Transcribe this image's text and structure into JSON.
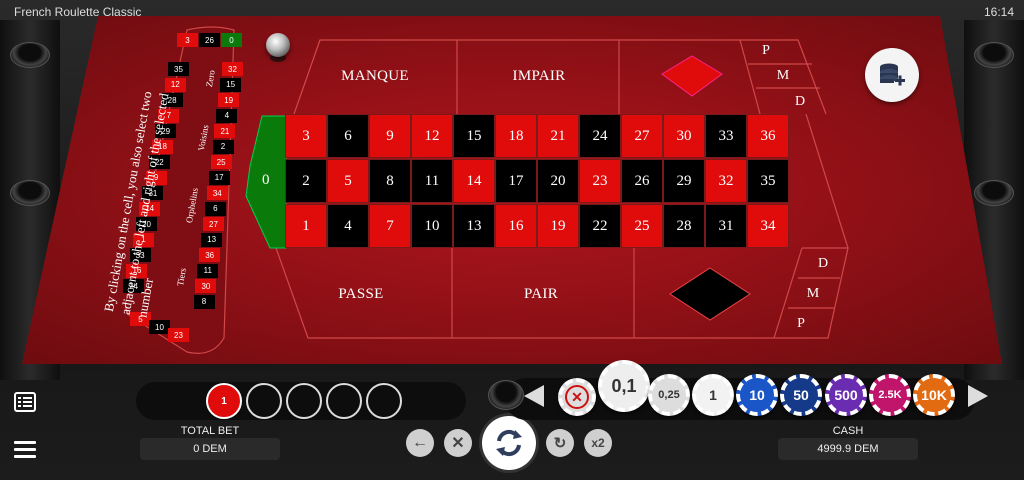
{
  "app": {
    "title": "French Roulette Classic",
    "clock": "16:14"
  },
  "table": {
    "outside_top": [
      "MANQUE",
      "IMPAIR"
    ],
    "outside_bottom": [
      "PASSE",
      "PAIR"
    ],
    "pmd_top": [
      "P",
      "M",
      "D"
    ],
    "pmd_bottom": [
      "D",
      "M",
      "P"
    ],
    "zero": "0",
    "rows": [
      [
        {
          "n": "3",
          "c": "red"
        },
        {
          "n": "6",
          "c": "black"
        },
        {
          "n": "9",
          "c": "red"
        },
        {
          "n": "12",
          "c": "red"
        },
        {
          "n": "15",
          "c": "black"
        },
        {
          "n": "18",
          "c": "red"
        },
        {
          "n": "21",
          "c": "red"
        },
        {
          "n": "24",
          "c": "black"
        },
        {
          "n": "27",
          "c": "red"
        },
        {
          "n": "30",
          "c": "red"
        },
        {
          "n": "33",
          "c": "black"
        },
        {
          "n": "36",
          "c": "red"
        }
      ],
      [
        {
          "n": "2",
          "c": "black"
        },
        {
          "n": "5",
          "c": "red"
        },
        {
          "n": "8",
          "c": "black"
        },
        {
          "n": "11",
          "c": "black"
        },
        {
          "n": "14",
          "c": "red"
        },
        {
          "n": "17",
          "c": "black"
        },
        {
          "n": "20",
          "c": "black"
        },
        {
          "n": "23",
          "c": "red"
        },
        {
          "n": "26",
          "c": "black"
        },
        {
          "n": "29",
          "c": "black"
        },
        {
          "n": "32",
          "c": "red"
        },
        {
          "n": "35",
          "c": "black"
        }
      ],
      [
        {
          "n": "1",
          "c": "red"
        },
        {
          "n": "4",
          "c": "black"
        },
        {
          "n": "7",
          "c": "red"
        },
        {
          "n": "10",
          "c": "black"
        },
        {
          "n": "13",
          "c": "black"
        },
        {
          "n": "16",
          "c": "red"
        },
        {
          "n": "19",
          "c": "red"
        },
        {
          "n": "22",
          "c": "black"
        },
        {
          "n": "25",
          "c": "red"
        },
        {
          "n": "28",
          "c": "black"
        },
        {
          "n": "31",
          "c": "black"
        },
        {
          "n": "34",
          "c": "red"
        }
      ]
    ]
  },
  "racetrack": {
    "instruction": "By clicking on the cell, you also select two adjacent to the left and right of the selected number",
    "sections": [
      "Zero",
      "Voisins",
      "Orphelins",
      "Tiers"
    ],
    "top": [
      {
        "n": "3",
        "c": "red"
      },
      {
        "n": "26",
        "c": "black"
      },
      {
        "n": "0",
        "c": "green"
      }
    ],
    "left": [
      {
        "n": "35",
        "c": "black"
      },
      {
        "n": "12",
        "c": "red"
      },
      {
        "n": "28",
        "c": "black"
      },
      {
        "n": "7",
        "c": "red"
      },
      {
        "n": "29",
        "c": "black"
      },
      {
        "n": "18",
        "c": "red"
      },
      {
        "n": "22",
        "c": "black"
      },
      {
        "n": "9",
        "c": "red"
      },
      {
        "n": "31",
        "c": "black"
      },
      {
        "n": "14",
        "c": "red"
      },
      {
        "n": "20",
        "c": "black"
      },
      {
        "n": "1",
        "c": "red"
      },
      {
        "n": "33",
        "c": "black"
      },
      {
        "n": "16",
        "c": "red"
      },
      {
        "n": "24",
        "c": "black"
      }
    ],
    "right": [
      {
        "n": "32",
        "c": "red"
      },
      {
        "n": "15",
        "c": "black"
      },
      {
        "n": "19",
        "c": "red"
      },
      {
        "n": "4",
        "c": "black"
      },
      {
        "n": "21",
        "c": "red"
      },
      {
        "n": "2",
        "c": "black"
      },
      {
        "n": "25",
        "c": "red"
      },
      {
        "n": "17",
        "c": "black"
      },
      {
        "n": "34",
        "c": "red"
      },
      {
        "n": "6",
        "c": "black"
      },
      {
        "n": "27",
        "c": "red"
      },
      {
        "n": "13",
        "c": "black"
      },
      {
        "n": "36",
        "c": "red"
      },
      {
        "n": "11",
        "c": "black"
      },
      {
        "n": "30",
        "c": "red"
      },
      {
        "n": "8",
        "c": "black"
      }
    ],
    "bottom": [
      {
        "n": "5",
        "c": "red"
      },
      {
        "n": "10",
        "c": "black"
      },
      {
        "n": "23",
        "c": "red"
      }
    ]
  },
  "history": {
    "numbers": [
      "1"
    ]
  },
  "total_bet": {
    "label": "TOTAL BET",
    "value": "0 DEM"
  },
  "cash": {
    "label": "CASH",
    "value": "4999.9 DEM"
  },
  "controls": {
    "double_label": "x2"
  },
  "chips": [
    {
      "label": "0,1",
      "color": "#eeeeee",
      "selected": true
    },
    {
      "label": "0,25",
      "color": "#dddddd"
    },
    {
      "label": "1",
      "color": "#f2f2f2"
    },
    {
      "label": "10",
      "color": "#1a56c8"
    },
    {
      "label": "50",
      "color": "#163a8a"
    },
    {
      "label": "500",
      "color": "#6a2cb0"
    },
    {
      "label": "2.5K",
      "color": "#c0156a"
    },
    {
      "label": "10K",
      "color": "#e26a10"
    }
  ],
  "colors": {
    "felt": "#a0131a",
    "red": "#e00c0c",
    "black": "#000000",
    "green": "#0a7a0a"
  }
}
